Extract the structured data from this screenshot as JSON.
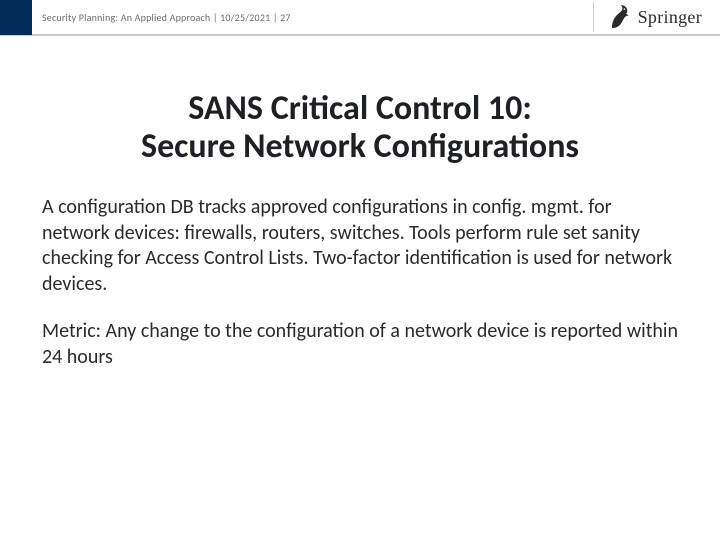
{
  "header": {
    "text": "Security Planning: An Applied Approach | 10/25/2021 | 27",
    "publisher": "Springer"
  },
  "slide": {
    "title": "SANS Critical Control 10:\nSecure Network Configurations",
    "body_paragraphs": [
      "A configuration DB tracks approved configurations in config. mgmt. for network devices: firewalls, routers, switches. Tools perform rule set sanity checking for Access Control Lists. Two-factor identification is used for network devices.",
      "Metric:  Any change to the configuration of a network device is reported within 24 hours"
    ]
  }
}
